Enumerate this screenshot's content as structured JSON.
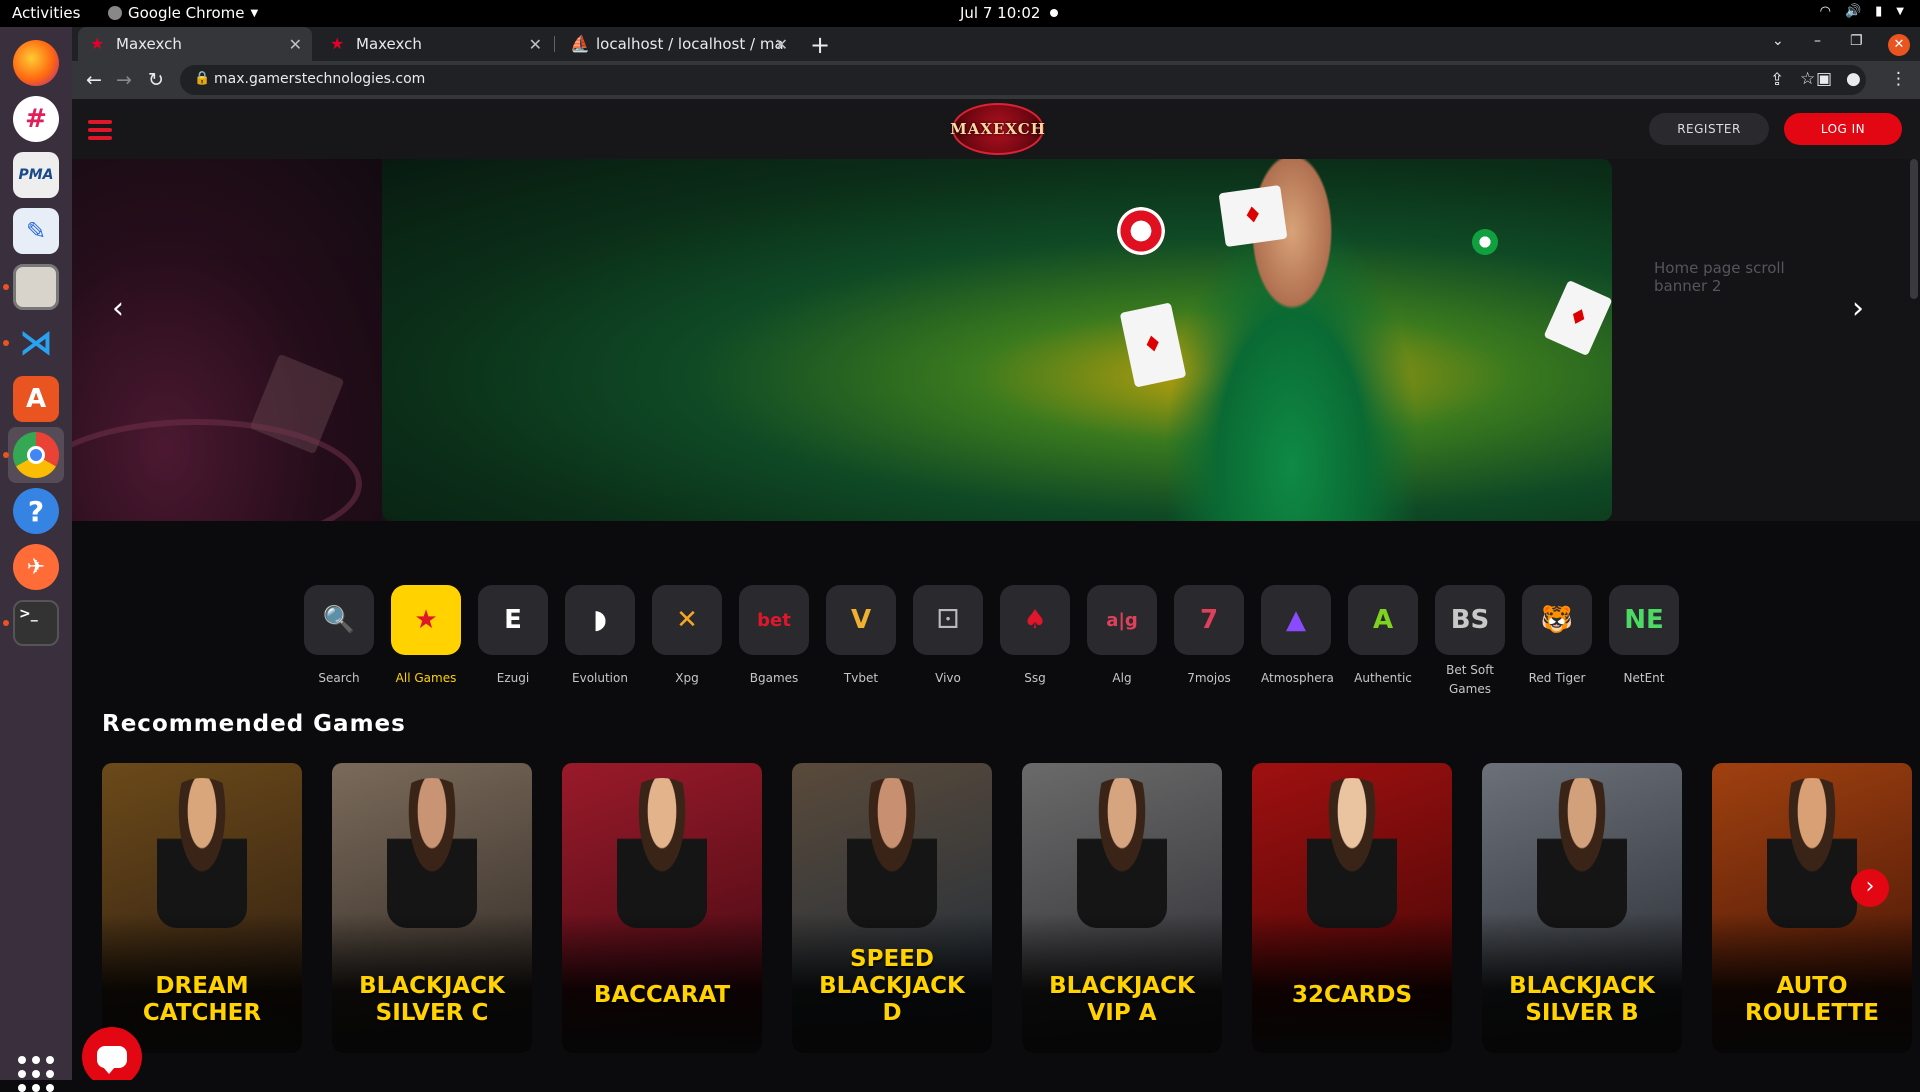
{
  "topbar": {
    "activities": "Activities",
    "app_name": "Google Chrome",
    "datetime": "Jul 7  10:02"
  },
  "dock": {
    "items": [
      "firefox-icon",
      "slack-icon",
      "phpmyadmin-icon",
      "text-editor-icon",
      "files-icon",
      "vscode-icon",
      "app-center-icon",
      "chrome-icon",
      "help-icon",
      "postman-icon",
      "terminal-icon"
    ]
  },
  "browser": {
    "tabs": [
      {
        "title": "Maxexch"
      },
      {
        "title": "Maxexch"
      },
      {
        "title": "localhost / localhost / ma"
      }
    ],
    "url": "max.gamerstechnologies.com"
  },
  "site": {
    "logo_text": "MAXEXCH",
    "register": "REGISTER",
    "login": "LOG IN",
    "banner_caption": "Home page scroll banner 2",
    "providers": [
      {
        "label": "Search",
        "glyph": "🔍",
        "color": "#ffffff"
      },
      {
        "label": "All Games",
        "glyph": "★",
        "color": "#e0162b"
      },
      {
        "label": "Ezugi",
        "glyph": "E",
        "color": "#ffffff"
      },
      {
        "label": "Evolution",
        "glyph": "◗",
        "color": "#ffffff"
      },
      {
        "label": "Xpg",
        "glyph": "✕",
        "color": "#f5a623"
      },
      {
        "label": "Bgames",
        "glyph": "bet",
        "color": "#e0162b"
      },
      {
        "label": "Tvbet",
        "glyph": "V",
        "color": "#f0b030"
      },
      {
        "label": "Vivo",
        "glyph": "⚀",
        "color": "#bbbbbb"
      },
      {
        "label": "Ssg",
        "glyph": "♠",
        "color": "#e0162b"
      },
      {
        "label": "Alg",
        "glyph": "a|g",
        "color": "#e0405a"
      },
      {
        "label": "7mojos",
        "glyph": "7",
        "color": "#e0405a"
      },
      {
        "label": "Atmosphera",
        "glyph": "▲",
        "color": "#8a4bff"
      },
      {
        "label": "Authentic",
        "glyph": "A",
        "color": "#7ed321"
      },
      {
        "label": "Bet Soft Games",
        "glyph": "BS",
        "color": "#c8c8c8"
      },
      {
        "label": "Red Tiger",
        "glyph": "🐯",
        "color": "#e0162b"
      },
      {
        "label": "NetEnt",
        "glyph": "NE",
        "color": "#4cd964"
      }
    ],
    "recommended_title": "Recommended Games",
    "games": [
      {
        "name": "DREAM CATCHER",
        "bg": "#6b4a1a",
        "bg2": "#2a1a10",
        "skin": "#d9a57a"
      },
      {
        "name": "BLACKJACK SILVER C",
        "bg": "#7a6a5a",
        "bg2": "#2a2420",
        "skin": "#c99474"
      },
      {
        "name": "BACCARAT",
        "bg": "#9a1a2a",
        "bg2": "#3a0810",
        "skin": "#e3b48c"
      },
      {
        "name": "SPEED BLACKJACK D",
        "bg": "#5a4a3a",
        "bg2": "#1a2a3a",
        "skin": "#c89070"
      },
      {
        "name": "BLACKJACK VIP A",
        "bg": "#6a6a6a",
        "bg2": "#2a2a30",
        "skin": "#d7a480"
      },
      {
        "name": "32CARDS",
        "bg": "#a01010",
        "bg2": "#3a0505",
        "skin": "#eac3a0"
      },
      {
        "name": "BLACKJACK SILVER B",
        "bg": "#6c7078",
        "bg2": "#22262c",
        "skin": "#d2a07a"
      },
      {
        "name": "AUTO ROULETTE",
        "bg": "#a04010",
        "bg2": "#3a1005",
        "skin": "#d8a074"
      }
    ]
  }
}
